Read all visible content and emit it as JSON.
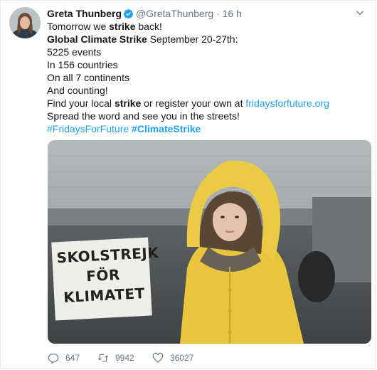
{
  "author": {
    "name": "Greta Thunberg",
    "handle": "@GretaThunberg",
    "separator": "·",
    "time": "16 h"
  },
  "tweet": {
    "line1_pre": "Tomorrow we ",
    "line1_bold": "strike",
    "line1_post": " back!",
    "line2_bold": "Global Climate Strike",
    "line2_post": " September 20-27th:",
    "line3": "5225 events",
    "line4": "In 156 countries",
    "line5": "On all 7 continents",
    "line6": "And counting!",
    "line7_pre": "Find your local ",
    "line7_bold": "strike",
    "line7_mid": " or register your own at ",
    "line7_link": "fridaysforfuture.org",
    "line8": "Spread the word and see you in the streets!",
    "hashtag1": "#FridaysForFuture",
    "hashtag2": "#ClimateStrike"
  },
  "media": {
    "sign_line1": "SKOLSTREJK",
    "sign_line2": "FÖR",
    "sign_line3": "KLIMATET"
  },
  "actions": {
    "replies": "647",
    "retweets": "9942",
    "likes": "36027"
  },
  "colors": {
    "accent": "#1da1f2",
    "muted": "#657786",
    "jacket": "#e9c53c"
  }
}
